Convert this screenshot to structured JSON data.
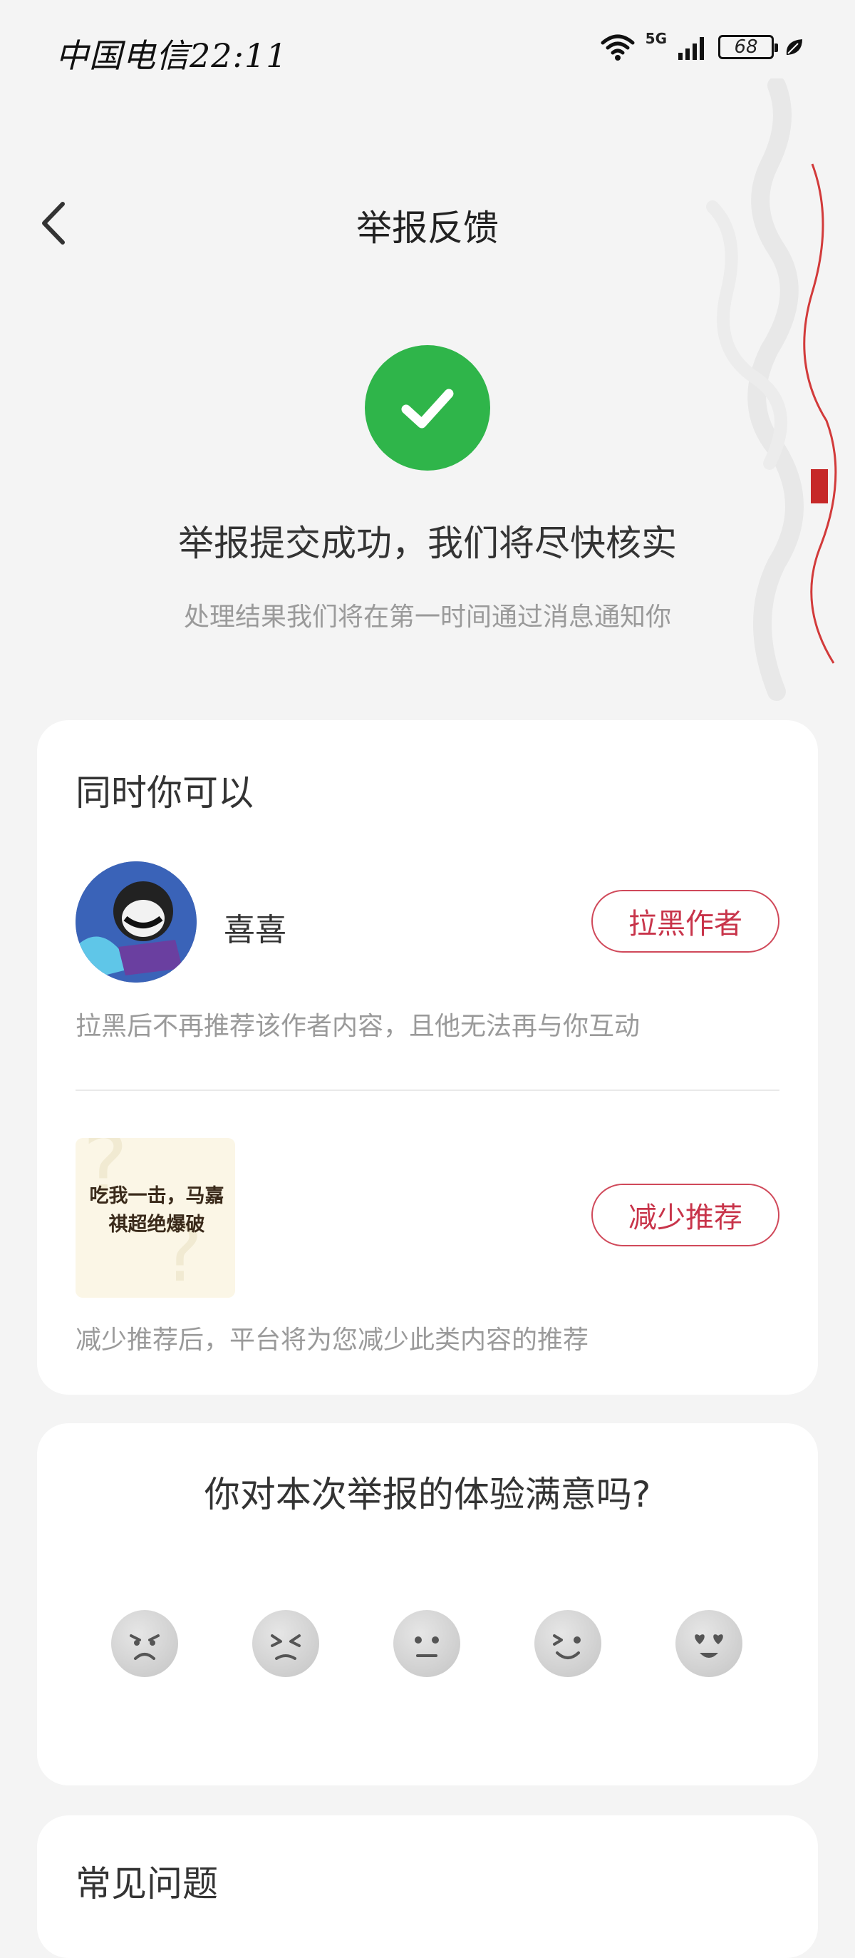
{
  "status_bar": {
    "carrier_time": "中国电信22:11",
    "network": "5G",
    "battery": "68"
  },
  "header": {
    "title": "举报反馈"
  },
  "success": {
    "title": "举报提交成功，我们将尽快核实",
    "subtitle": "处理结果我们将在第一时间通过消息通知你",
    "icon_color": "#2fb54a"
  },
  "actions_card": {
    "title": "同时你可以",
    "author": {
      "name": "喜喜",
      "button": "拉黑作者",
      "hint": "拉黑后不再推荐该作者内容，且他无法再与你互动"
    },
    "content": {
      "thumb_text": "吃我一击，马嘉祺超绝爆破",
      "button": "减少推荐",
      "hint": "减少推荐后，平台将为您减少此类内容的推荐"
    },
    "accent_color": "#c8344a"
  },
  "survey": {
    "question": "你对本次举报的体验满意吗?",
    "faces": [
      "very-dissatisfied",
      "dissatisfied",
      "neutral",
      "satisfied",
      "very-satisfied"
    ]
  },
  "faq": {
    "title": "常见问题"
  }
}
